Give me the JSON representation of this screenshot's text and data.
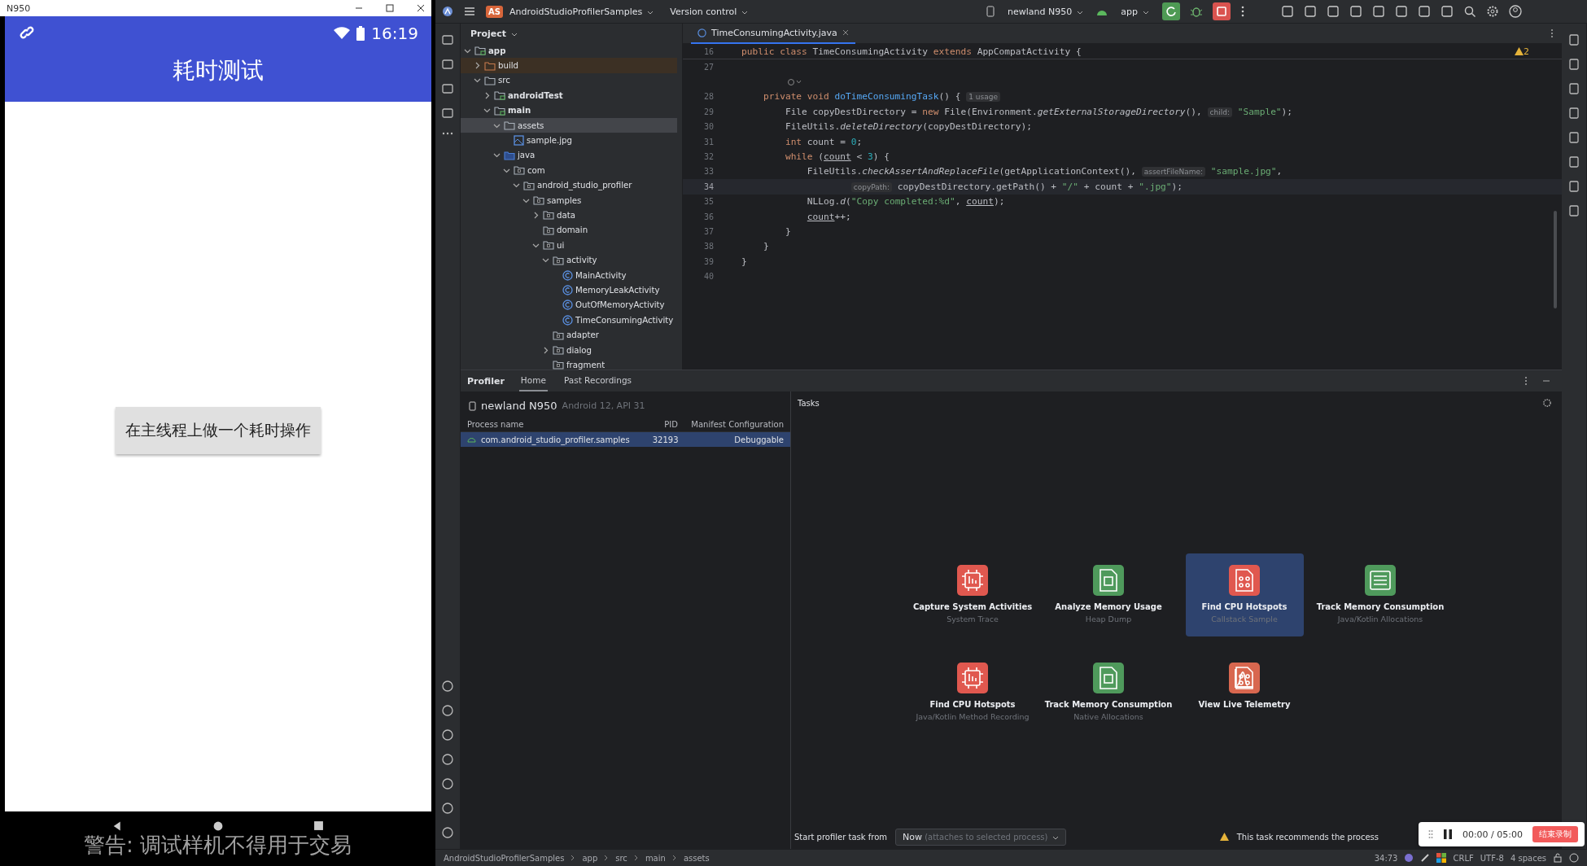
{
  "emulator": {
    "title": "N950",
    "time": "16:19",
    "app_title": "耗时测试",
    "button": "在主线程上做一个耗时操作",
    "warning": "警告: 调试样机不得用于交易"
  },
  "ide": {
    "project_badge": "AS",
    "project": "AndroidStudioProfilerSamples",
    "vcs": "Version control",
    "device": "newland N950",
    "run_config": "app"
  },
  "project_panel": {
    "title": "Project",
    "tree": [
      {
        "label": "app",
        "kind": "module",
        "selected": false,
        "expanded": true,
        "children": [
          {
            "label": "build",
            "kind": "excluded",
            "selected": false,
            "expanded": false
          },
          {
            "label": "src",
            "kind": "folder",
            "selected": false,
            "expanded": true,
            "children": [
              {
                "label": "androidTest",
                "kind": "module",
                "selected": false,
                "expanded": false
              },
              {
                "label": "main",
                "kind": "module",
                "selected": false,
                "expanded": true,
                "children": [
                  {
                    "label": "assets",
                    "kind": "resources",
                    "selected": true,
                    "expanded": true,
                    "children": [
                      {
                        "label": "sample.jpg",
                        "kind": "image",
                        "selected": false
                      }
                    ]
                  },
                  {
                    "label": "java",
                    "kind": "source",
                    "selected": false,
                    "expanded": true,
                    "children": [
                      {
                        "label": "com",
                        "kind": "package",
                        "selected": false,
                        "expanded": true,
                        "children": [
                          {
                            "label": "android_studio_profiler",
                            "kind": "package",
                            "selected": false,
                            "expanded": true,
                            "children": [
                              {
                                "label": "samples",
                                "kind": "package",
                                "selected": false,
                                "expanded": true,
                                "children": [
                                  {
                                    "label": "data",
                                    "kind": "package",
                                    "selected": false,
                                    "expanded": false
                                  },
                                  {
                                    "label": "domain",
                                    "kind": "package",
                                    "selected": false
                                  },
                                  {
                                    "label": "ui",
                                    "kind": "package",
                                    "selected": false,
                                    "expanded": true,
                                    "children": [
                                      {
                                        "label": "activity",
                                        "kind": "package",
                                        "selected": false,
                                        "expanded": true,
                                        "children": [
                                          {
                                            "label": "MainActivity",
                                            "kind": "class",
                                            "selected": false
                                          },
                                          {
                                            "label": "MemoryLeakActivity",
                                            "kind": "class",
                                            "selected": false
                                          },
                                          {
                                            "label": "OutOfMemoryActivity",
                                            "kind": "class",
                                            "selected": false
                                          },
                                          {
                                            "label": "TimeConsumingActivity",
                                            "kind": "class",
                                            "selected": false
                                          }
                                        ]
                                      },
                                      {
                                        "label": "adapter",
                                        "kind": "package",
                                        "selected": false
                                      },
                                      {
                                        "label": "dialog",
                                        "kind": "package",
                                        "selected": false,
                                        "expanded": false
                                      },
                                      {
                                        "label": "fragment",
                                        "kind": "package",
                                        "selected": false
                                      }
                                    ]
                                  }
                                ]
                              }
                            ]
                          }
                        ]
                      }
                    ]
                  }
                ]
              }
            ]
          }
        ]
      }
    ]
  },
  "editor": {
    "tab": "TimeConsumingActivity.java",
    "warnings": "2",
    "sticky": {
      "number": "16",
      "tokens": [
        {
          "kind": "kw",
          "text": "public class "
        },
        {
          "kind": "plain",
          "text": "TimeConsumingActivity "
        },
        {
          "kind": "kw",
          "text": "extends "
        },
        {
          "kind": "plain",
          "text": "AppCompatActivity {"
        }
      ]
    },
    "lines": [
      {
        "number": "27",
        "current": false
      },
      {
        "kind": "lens",
        "current": false
      },
      {
        "number": "28",
        "current": false,
        "tokens": [
          {
            "kind": "kw",
            "text": "    private void "
          },
          {
            "kind": "fn",
            "text": "doTimeConsumingTask"
          },
          {
            "kind": "plain",
            "text": "() { "
          },
          {
            "kind": "hint",
            "text": "1 usage"
          }
        ]
      },
      {
        "number": "29",
        "current": false,
        "tokens": [
          {
            "kind": "plain",
            "text": "        File copyDestDirectory = "
          },
          {
            "kind": "kw",
            "text": "new "
          },
          {
            "kind": "plain",
            "text": "File(Environment."
          },
          {
            "kind": "ital",
            "text": "getExternalStorageDirectory"
          },
          {
            "kind": "plain",
            "text": "(), "
          },
          {
            "kind": "hint",
            "text": "child:"
          },
          {
            "kind": "str",
            "text": " \"Sample\""
          },
          {
            "kind": "plain",
            "text": ");"
          }
        ]
      },
      {
        "number": "30",
        "current": false,
        "tokens": [
          {
            "kind": "plain",
            "text": "        FileUtils."
          },
          {
            "kind": "ital",
            "text": "deleteDirectory"
          },
          {
            "kind": "plain",
            "text": "(copyDestDirectory);"
          }
        ]
      },
      {
        "number": "31",
        "current": false,
        "tokens": [
          {
            "kind": "kw",
            "text": "        int "
          },
          {
            "kind": "plain",
            "text": "count = "
          },
          {
            "kind": "num",
            "text": "0"
          },
          {
            "kind": "plain",
            "text": ";"
          }
        ]
      },
      {
        "number": "32",
        "current": false,
        "tokens": [
          {
            "kind": "kw",
            "text": "        while "
          },
          {
            "kind": "plain",
            "text": "("
          },
          {
            "kind": "under",
            "text": "count"
          },
          {
            "kind": "plain",
            "text": " < "
          },
          {
            "kind": "num",
            "text": "3"
          },
          {
            "kind": "plain",
            "text": ") {"
          }
        ]
      },
      {
        "number": "33",
        "current": false,
        "tokens": [
          {
            "kind": "plain",
            "text": "            FileUtils."
          },
          {
            "kind": "ital",
            "text": "checkAssertAndReplaceFile"
          },
          {
            "kind": "plain",
            "text": "(getApplicationContext(), "
          },
          {
            "kind": "hint",
            "text": "assertFileName:"
          },
          {
            "kind": "str",
            "text": " \"sample.jpg\""
          },
          {
            "kind": "plain",
            "text": ","
          }
        ]
      },
      {
        "number": "34",
        "current": true,
        "tokens": [
          {
            "kind": "hint",
            "text": "                    copyPath:"
          },
          {
            "kind": "plain",
            "text": " copyDestDirectory.getPath() + "
          },
          {
            "kind": "str",
            "text": "\"/\""
          },
          {
            "kind": "plain",
            "text": " + count + "
          },
          {
            "kind": "str",
            "text": "\".jpg\""
          },
          {
            "kind": "plain",
            "text": ");"
          }
        ]
      },
      {
        "number": "35",
        "current": false,
        "tokens": [
          {
            "kind": "plain",
            "text": "            NLLog."
          },
          {
            "kind": "ital",
            "text": "d"
          },
          {
            "kind": "plain",
            "text": "("
          },
          {
            "kind": "str",
            "text": "\"Copy completed:%d\""
          },
          {
            "kind": "plain",
            "text": ", "
          },
          {
            "kind": "under",
            "text": "count"
          },
          {
            "kind": "plain",
            "text": ");"
          }
        ]
      },
      {
        "number": "36",
        "current": false,
        "tokens": [
          {
            "kind": "under",
            "text": "            count"
          },
          {
            "kind": "plain",
            "text": "++;"
          }
        ]
      },
      {
        "number": "37",
        "current": false,
        "tokens": [
          {
            "kind": "plain",
            "text": "        }"
          }
        ]
      },
      {
        "number": "38",
        "current": false,
        "tokens": [
          {
            "kind": "plain",
            "text": "    }"
          }
        ]
      },
      {
        "number": "39",
        "current": false,
        "tokens": [
          {
            "kind": "plain",
            "text": "}"
          }
        ]
      },
      {
        "number": "40",
        "current": false
      }
    ]
  },
  "profiler": {
    "title": "Profiler",
    "tabs": [
      {
        "label": "Home",
        "selected": true
      },
      {
        "label": "Past Recordings",
        "selected": false
      }
    ],
    "device": "newland N950",
    "device_info": "Android 12, API 31",
    "columns": [
      "Process name",
      "PID",
      "Manifest Configuration"
    ],
    "rows": [
      {
        "name": "com.android_studio_profiler.samples",
        "pid": "32193",
        "config": "Debuggable",
        "selected": true
      }
    ],
    "tasks_title": "Tasks",
    "tasks": [
      {
        "title": "Capture System Activities",
        "subtitle": "System Trace",
        "color": "#e0584f",
        "selected": false
      },
      {
        "title": "Analyze Memory Usage",
        "subtitle": "Heap Dump",
        "color": "#4f9a5c",
        "selected": false
      },
      {
        "title": "Find CPU Hotspots",
        "subtitle": "Callstack Sample",
        "color": "#e0584f",
        "selected": true
      },
      {
        "title": "Track Memory Consumption",
        "subtitle": "Java/Kotlin Allocations",
        "color": "#4f9a5c",
        "selected": false
      },
      {
        "title": "Find CPU Hotspots",
        "subtitle": "Java/Kotlin Method Recording",
        "color": "#e0584f",
        "selected": false
      },
      {
        "title": "Track Memory Consumption",
        "subtitle": "Native Allocations",
        "color": "#4f9a5c",
        "selected": false
      },
      {
        "title": "View Live Telemetry",
        "color": "#d8674f",
        "selected": false
      }
    ],
    "start_label": "Start profiler task from",
    "start_value": "Now",
    "start_hint": "(attaches to selected process)",
    "recommendation": "This task recommends the process"
  },
  "recorder": {
    "time": "00:00 / 05:00",
    "stop": "结束录制"
  },
  "status_bar": {
    "breadcrumbs": [
      "AndroidStudioProfilerSamples",
      "app",
      "src",
      "main",
      "assets"
    ],
    "position": "34:73",
    "line_ending": "CRLF",
    "encoding": "UTF-8",
    "indent": "4 spaces"
  }
}
